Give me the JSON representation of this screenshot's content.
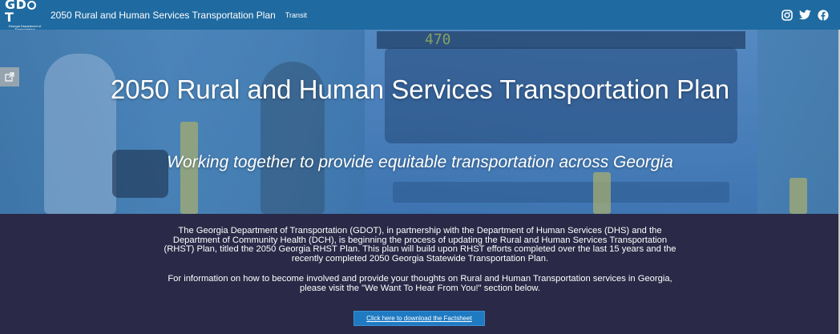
{
  "header": {
    "logo_text": "GDOT",
    "logo_subtext": "Georgia Department of Transportation",
    "site_title": "2050 Rural and Human Services Transportation Plan",
    "nav_link": "Transit",
    "social_icons": [
      "instagram-icon",
      "twitter-icon",
      "facebook-icon"
    ]
  },
  "hero": {
    "title": "2050 Rural and Human Services Transportation Plan",
    "subtitle": "Working together to provide equitable transportation across Georgia",
    "bus_sign": "470"
  },
  "content": {
    "paragraph1": "The Georgia Department of Transportation (GDOT), in partnership with the Department of Human Services (DHS) and the Department of Community Health (DCH), is beginning the process of updating the Rural and Human Services Transportation (RHST) Plan, titled the 2050 Georgia RHST Plan. This plan will build upon RHST efforts completed over the last 15 years and the recently completed 2050 Georgia Statewide Transportation Plan.",
    "paragraph2": "For information on how to become involved and provide your thoughts on Rural and Human Transportation services in Georgia, please visit the \"We Want To Hear From You!\" section below.",
    "download_button": "Click here to download the Factsheet"
  },
  "colors": {
    "header_bg": "#1f6aa0",
    "content_bg": "#2a2947",
    "button_bg": "#1f7ac2"
  }
}
